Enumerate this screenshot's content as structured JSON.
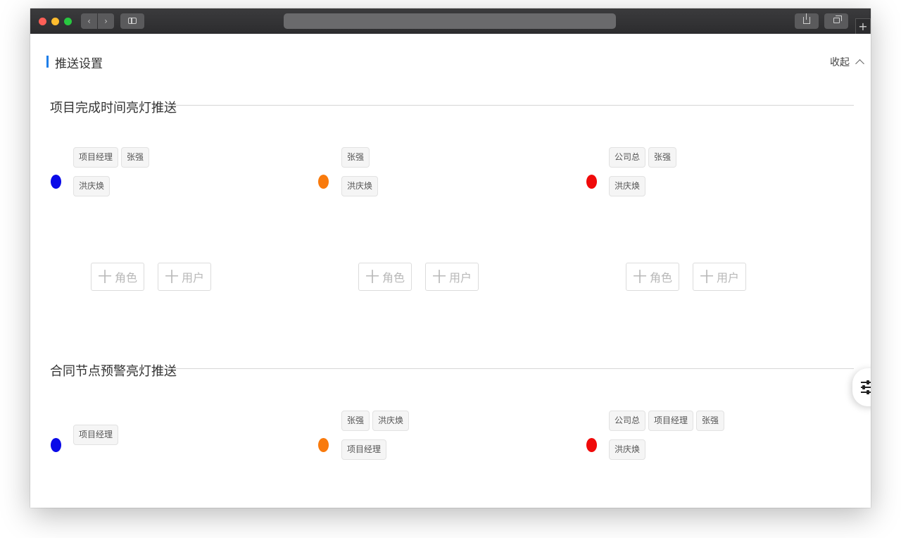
{
  "browser": {
    "back_glyph": "‹",
    "forward_glyph": "›",
    "new_tab_glyph": "+"
  },
  "header": {
    "title": "推送设置",
    "collapse_label": "收起",
    "accent_color": "#1e7ee8"
  },
  "sections": [
    {
      "title": "项目完成时间亮灯推送",
      "columns": [
        {
          "light_color": "blue",
          "tag_rows": [
            [
              "项目经理",
              "张强"
            ],
            [
              "洪庆焕"
            ]
          ]
        },
        {
          "light_color": "orange",
          "tag_rows": [
            [
              "张强"
            ],
            [
              "洪庆焕"
            ]
          ]
        },
        {
          "light_color": "red",
          "tag_rows": [
            [
              "公司总",
              "张强"
            ],
            [
              "洪庆焕"
            ]
          ]
        }
      ],
      "buttons": {
        "add_role": "角色",
        "add_user": "用户",
        "plus": "十"
      }
    },
    {
      "title": "合同节点预警亮灯推送",
      "columns": [
        {
          "light_color": "blue",
          "tag_rows": [
            [
              "项目经理"
            ]
          ]
        },
        {
          "light_color": "orange",
          "tag_rows": [
            [
              "张强",
              "洪庆焕"
            ],
            [
              "项目经理"
            ]
          ]
        },
        {
          "light_color": "red",
          "tag_rows": [
            [
              "公司总",
              "项目经理",
              "张强"
            ],
            [
              "洪庆焕"
            ]
          ]
        }
      ]
    }
  ],
  "colors": {
    "blue": "#0a0ae8",
    "orange": "#f97a0c",
    "red": "#f00a0a"
  },
  "icons": [
    "sidebar-toggle-icon",
    "share-icon",
    "tabs-icon",
    "chevron-up-icon",
    "settings-sliders-icon"
  ]
}
